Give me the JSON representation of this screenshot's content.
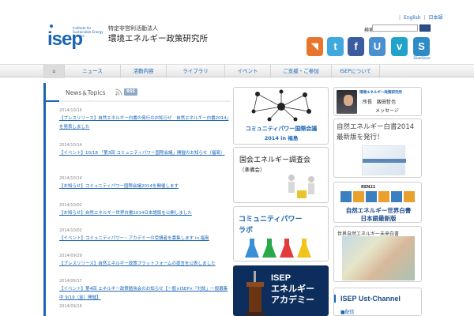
{
  "header": {
    "logo_text": "isep",
    "logo_tagline": "Institute for Sustainable Energy Policies",
    "org_type": "特定非営利活動法人",
    "org_name": "環境エネルギー政策研究所",
    "lang": {
      "english": "English",
      "sep": "|",
      "japanese": "日本語"
    },
    "search": {
      "label": "検索",
      "value": "",
      "button": ""
    },
    "social": [
      {
        "name": "rss",
        "glyph": "◥",
        "color": "#e9742b"
      },
      {
        "name": "twitter",
        "glyph": "t",
        "color": "#3ea8df"
      },
      {
        "name": "facebook",
        "glyph": "f",
        "color": "#3b5c9e"
      },
      {
        "name": "ustream",
        "glyph": "U",
        "color": "#4a8fcf"
      },
      {
        "name": "vimeo",
        "glyph": "v",
        "color": "#20a3c9"
      },
      {
        "name": "slideshare",
        "glyph": "S",
        "color": "#2e8bc6"
      }
    ],
    "social_caption": "SlideShare"
  },
  "nav": {
    "home": "⌂",
    "items": [
      "ニュース",
      "活動内容",
      "ライブラリ",
      "イベント",
      "ご支援・ご参加",
      "ISEPについて"
    ]
  },
  "news": {
    "title": "News＆Topics",
    "rss_label": "RSS",
    "items": [
      {
        "date": "2014/10/16",
        "text": "【プレスリリース】自然エネルギー白書の発行のお知らせ　自然エネルギー白書2014」を発表しました"
      },
      {
        "date": "2014/10/14",
        "text": "【イベント】10/18 「第3回 コミュニティパワー国際会議」開催のお知らせ（福島）"
      },
      {
        "date": "2014/10/14",
        "text": "【お知らせ】コミュニティパワー国際会議2014を開催します"
      },
      {
        "date": "2014/10/02",
        "text": "【お知らせ】自然エネルギー世界白書2014日本語版を公開しました"
      },
      {
        "date": "2014/10/02",
        "text": "【イベント】コミュニティパワー・アカデミーの受講者を募集します in 福島"
      },
      {
        "date": "2014/09/29",
        "text": "【プレスリリース】自然エネルギー政策プラットフォームの提言を公表しました"
      },
      {
        "date": "2014/09/17",
        "text": "【イベント】第4回 エネルギー政策勉強会のお知らせ【一般×ISEP×「対談」一般募集中 9/19（金）開催】"
      },
      {
        "date": "2014/09/16",
        "text": ""
      }
    ]
  },
  "banners": {
    "community_conf": {
      "title": "コミュニティパワー国際会議",
      "subtitle": "2014 in 福島"
    },
    "diet": {
      "title": "国会エネルギー調査会",
      "subtitle": "（準備会）"
    },
    "lab": {
      "title_line1": "コミュニティパワー",
      "title_line2": "ラボ"
    },
    "academy": {
      "line1": "ISEP",
      "line2": "エネルギー",
      "line3": "アカデミー"
    }
  },
  "side": {
    "director": {
      "org": "環境エネルギー政策研究所",
      "name": "所長　飯田哲也",
      "message": "メッセージ"
    },
    "whitepaper": {
      "line1": "自然エネルギー白書2014",
      "line2": "最新版を発行！"
    },
    "ren21": {
      "logo": "REN21",
      "line1": "自然エネルギー世界白書",
      "line2": "日本語最新版"
    },
    "future": {
      "title": "世界自然エネルギー未来白書"
    },
    "ust": {
      "title": "ISEP Ust-Channel",
      "subtitle": "■配信"
    }
  }
}
